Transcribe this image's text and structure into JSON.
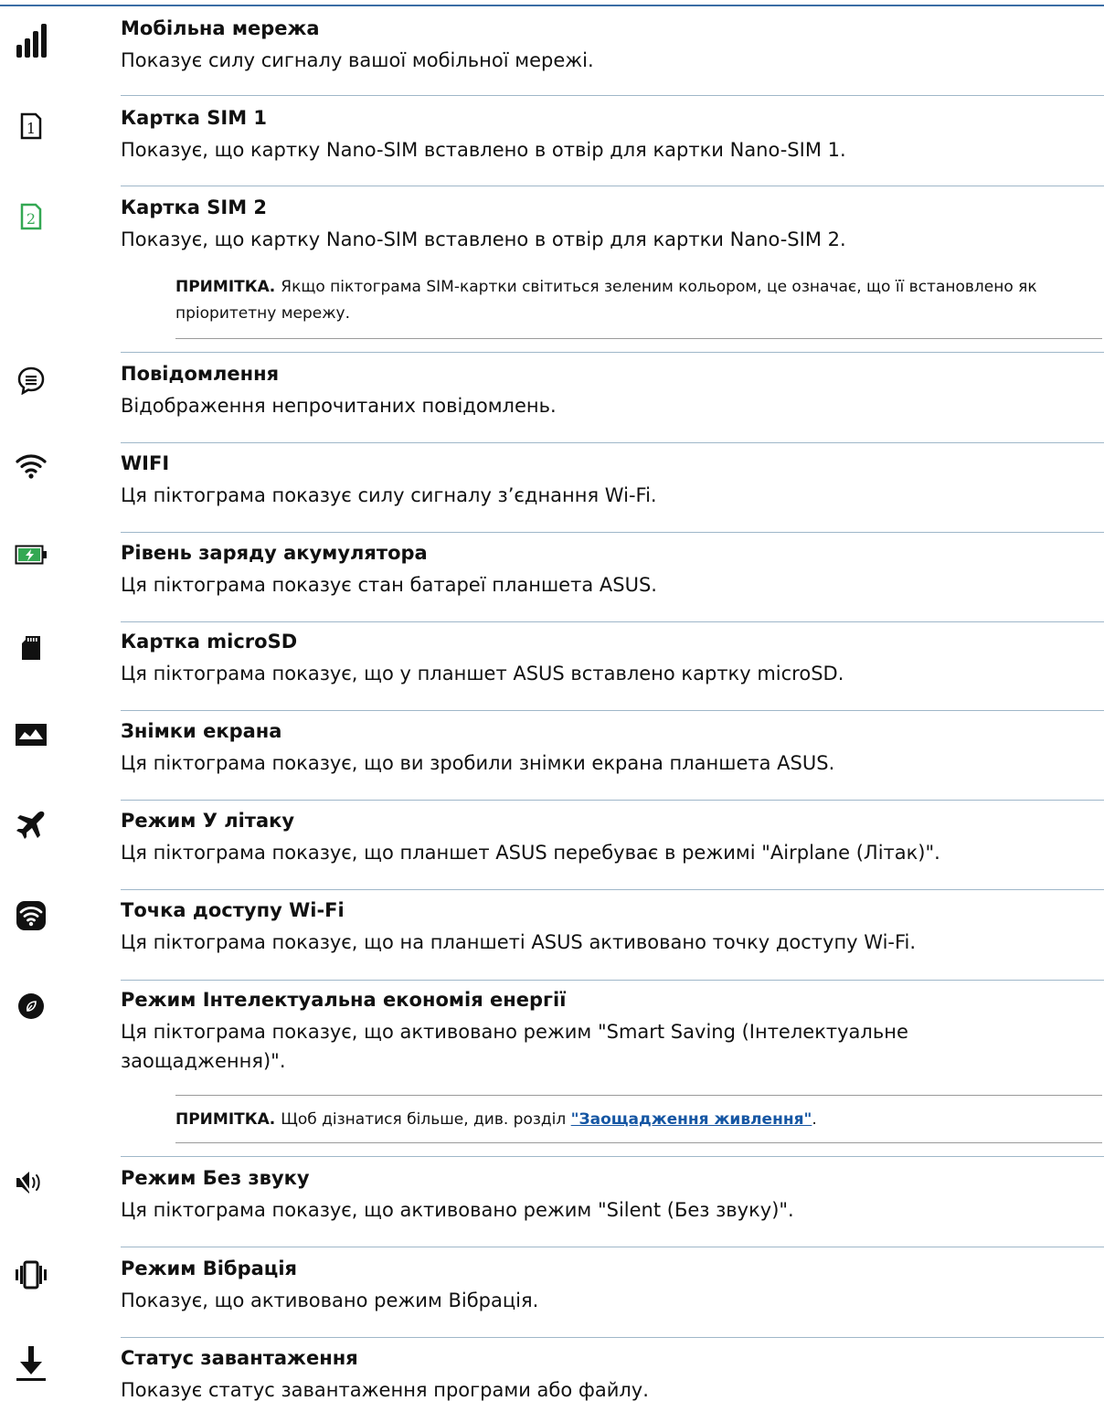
{
  "colors": {
    "rule": "#3b6ea5",
    "separator": "#9fb7c9",
    "link": "#1556a3",
    "sim2": "#34a853"
  },
  "items": [
    {
      "icon": "signal-bars-icon",
      "title": "Мобільна мережа",
      "desc": "Показує силу сигналу вашої мобільної мережі."
    },
    {
      "icon": "sim-1-icon",
      "title": "Картка SIM 1",
      "desc": "Показує, що картку Nano-SIM вставлено в отвір для картки Nano-SIM 1."
    },
    {
      "icon": "sim-2-icon",
      "title": "Картка SIM 2",
      "desc": "Показує, що картку Nano-SIM вставлено в отвір для картки Nano-SIM 2."
    },
    {
      "icon": "message-icon",
      "title": "Повідомлення",
      "desc": "Відображення непрочитаних повідомлень."
    },
    {
      "icon": "wifi-icon",
      "title": "WIFI",
      "desc": "Ця піктограма показує силу сигналу з’єднання Wi-Fi."
    },
    {
      "icon": "battery-charging-icon",
      "title": "Рівень заряду акумулятора",
      "desc": "Ця піктограма показує стан батареї планшета ASUS."
    },
    {
      "icon": "microsd-icon",
      "title": "Картка microSD",
      "desc": "Ця піктограма показує, що у планшет ASUS вставлено картку microSD."
    },
    {
      "icon": "screenshot-icon",
      "title": "Знімки екрана",
      "desc": "Ця піктограма показує, що ви зробили знімки екрана планшета ASUS."
    },
    {
      "icon": "airplane-icon",
      "title": "Режим У літаку",
      "desc": "Ця піктограма показує, що планшет ASUS перебуває в режимі \"Airplane (Літак)\"."
    },
    {
      "icon": "hotspot-icon",
      "title": "Точка доступу Wi-Fi",
      "desc": "Ця піктограма показує, що на планшеті ASUS активовано точку доступу Wi-Fi."
    },
    {
      "icon": "smart-saving-icon",
      "title": "Режим Інтелектуальна економія енергії",
      "desc": "Ця піктограма показує, що активовано режим \"Smart Saving (Інтелектуальне заощадження)\"."
    },
    {
      "icon": "silent-icon",
      "title": "Режим Без звуку",
      "desc": "Ця піктограма показує, що активовано режим \"Silent (Без звуку)\"."
    },
    {
      "icon": "vibrate-icon",
      "title": "Режим Вібрація",
      "desc": "Показує, що активовано режим Вібрація."
    },
    {
      "icon": "download-icon",
      "title": "Статус завантаження",
      "desc": "Показує статус завантаження програми або файлу."
    }
  ],
  "notes": {
    "sim": {
      "label": "ПРИМІТКА.",
      "text": "Якщо піктограма SIM-картки світиться зеленим кольором, це означає, що її встановлено як пріоритетну мережу."
    },
    "saving": {
      "label": "ПРИМІТКА.",
      "text_before": "Щоб дізнатися більше, див. розділ",
      "link": "\"Заощадження живлення\"",
      "text_after": "."
    }
  }
}
